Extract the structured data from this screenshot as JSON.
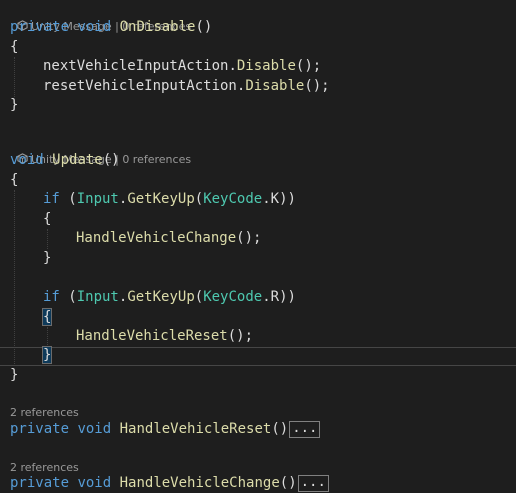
{
  "editor": {
    "codelens": {
      "unity_message": "Unity Message",
      "separator": " | ",
      "zero_references": "0 references",
      "two_references": "2 references"
    },
    "on_disable": {
      "access": "private",
      "ret": "void",
      "name": "OnDisable",
      "parens": "()",
      "open": "{",
      "close": "}",
      "line1_obj": "nextVehicleInputAction",
      "line1_call": "Disable",
      "line2_obj": "resetVehicleInputAction",
      "line2_call": "Disable",
      "dot": ".",
      "end": "();"
    },
    "update": {
      "ret": "void",
      "name": "Update",
      "parens": "()",
      "open": "{",
      "close": "}",
      "if_kw": "if",
      "paren_open": " (",
      "input_cls": "Input",
      "get_key_up": "GetKeyUp",
      "keycode_cls": "KeyCode",
      "key_k": "K",
      "key_r": "R",
      "if_tail": "))",
      "handle_change": "HandleVehicleChange",
      "handle_reset": "HandleVehicleReset",
      "call_end": "();"
    },
    "methods": {
      "access": "private",
      "ret": "void",
      "reset_name": "HandleVehicleReset",
      "change_name": "HandleVehicleChange",
      "parens": "()",
      "ellipsis": "..."
    }
  }
}
